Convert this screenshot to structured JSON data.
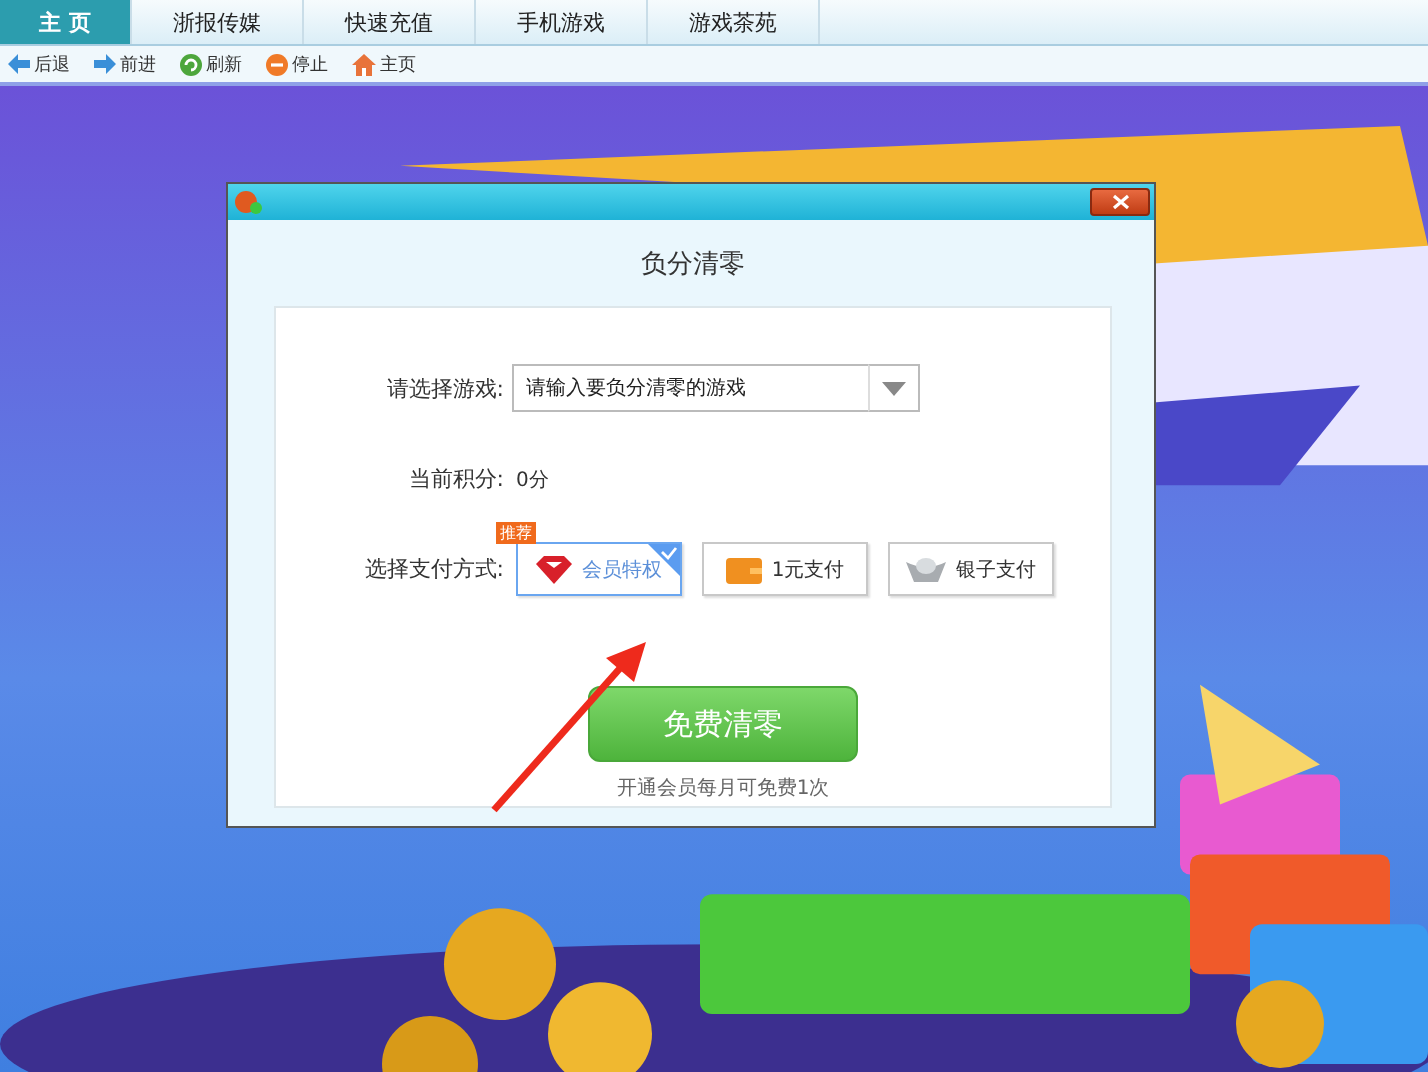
{
  "tabs": [
    {
      "label": "主 页",
      "selected": true
    },
    {
      "label": "浙报传媒",
      "selected": false
    },
    {
      "label": "快速充值",
      "selected": false
    },
    {
      "label": "手机游戏",
      "selected": false
    },
    {
      "label": "游戏茶苑",
      "selected": false
    }
  ],
  "toolbar": [
    "后退",
    "前进",
    "刷新",
    "停止",
    "主页"
  ],
  "dialog": {
    "title": "负分清零",
    "game_label": "请选择游戏:",
    "game_field": {
      "placeholder": "请输入要负分清零的游戏"
    },
    "score_label": "当前积分:",
    "score_value": "0分",
    "pay_label": "选择支付方式:",
    "pay_options": [
      {
        "label": "会员特权",
        "selected": true,
        "badge": "推荐"
      },
      {
        "label": "1元支付",
        "selected": false
      },
      {
        "label": "银子支付",
        "selected": false
      }
    ],
    "button": "免费清零",
    "hint": "开通会员每月可免费1次"
  }
}
